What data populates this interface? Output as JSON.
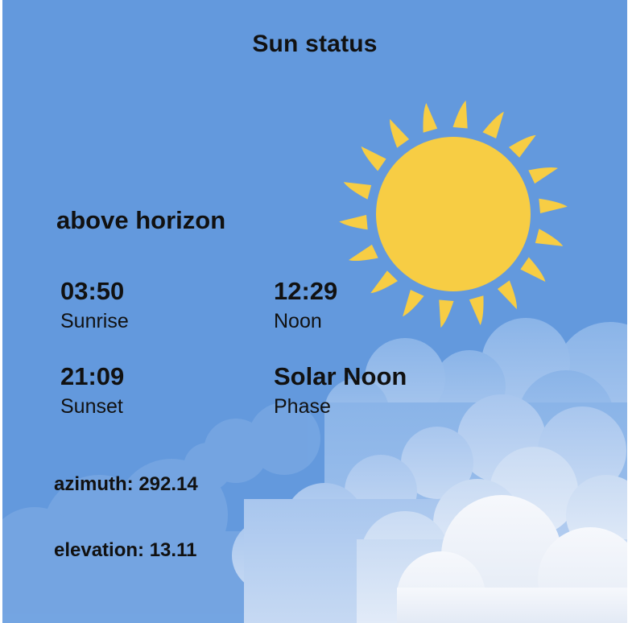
{
  "card": {
    "title": "Sun status",
    "state": "above horizon",
    "stats": {
      "sunrise": {
        "value": "03:50",
        "label": "Sunrise"
      },
      "noon": {
        "value": "12:29",
        "label": "Noon"
      },
      "sunset": {
        "value": "21:09",
        "label": "Sunset"
      },
      "phase": {
        "value": "Solar Noon",
        "label": "Phase"
      }
    },
    "azimuth_text": "azimuth: 292.14",
    "elevation_text": "elevation: 13.11"
  },
  "colors": {
    "sky": "#6399dd",
    "sun": "#f7cd44",
    "text": "#111111",
    "cloud": "#eef3fb"
  },
  "icons": {
    "sun": "sun-icon",
    "clouds": "clouds-illustration"
  }
}
